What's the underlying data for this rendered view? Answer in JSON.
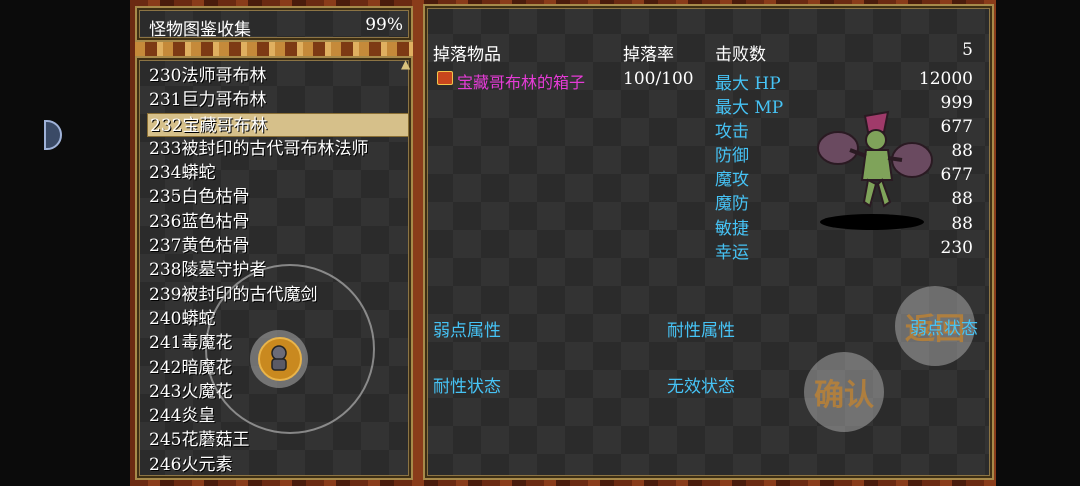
{
  "header": {
    "title": "怪物图鉴收集",
    "percent": "99%"
  },
  "monster_list": [
    "230法师哥布林",
    "231巨力哥布林",
    "232宝藏哥布林",
    "233被封印的古代哥布林法师",
    "234蟒蛇",
    "235白色枯骨",
    "236蓝色枯骨",
    "237黄色枯骨",
    "238陵墓守护者",
    "239被封印的古代魔剑",
    "240蟒蛇",
    "241毒魔花",
    "242暗魔花",
    "243火魔花",
    "244炎皇",
    "245花蘑菇王",
    "246火元素"
  ],
  "selected_index": 2,
  "detail": {
    "drop_header": "掉落物品",
    "rate_header": "掉落率",
    "defeat_header": "击败数",
    "defeat_count": "5",
    "drop_item": "宝藏哥布林的箱子",
    "drop_rate": "100/100",
    "stats": [
      {
        "label": "最大 HP",
        "value": "12000"
      },
      {
        "label": "最大 MP",
        "value": "999"
      },
      {
        "label": "攻击",
        "value": "677"
      },
      {
        "label": "防御",
        "value": "88"
      },
      {
        "label": "魔攻",
        "value": "677"
      },
      {
        "label": "魔防",
        "value": "88"
      },
      {
        "label": "敏捷",
        "value": "88"
      },
      {
        "label": "幸运",
        "value": "230"
      }
    ],
    "weak_attr": "弱点属性",
    "resist_attr": "耐性属性",
    "weak_state": "弱点状态",
    "resist_state": "耐性状态",
    "invalid_state": "无效状态"
  },
  "controls": {
    "back": "返回",
    "confirm": "确认"
  },
  "colors": {
    "stat_label": "#46c3f5",
    "drop_item": "#e53bd6",
    "selected_row": "#d6c08a"
  }
}
